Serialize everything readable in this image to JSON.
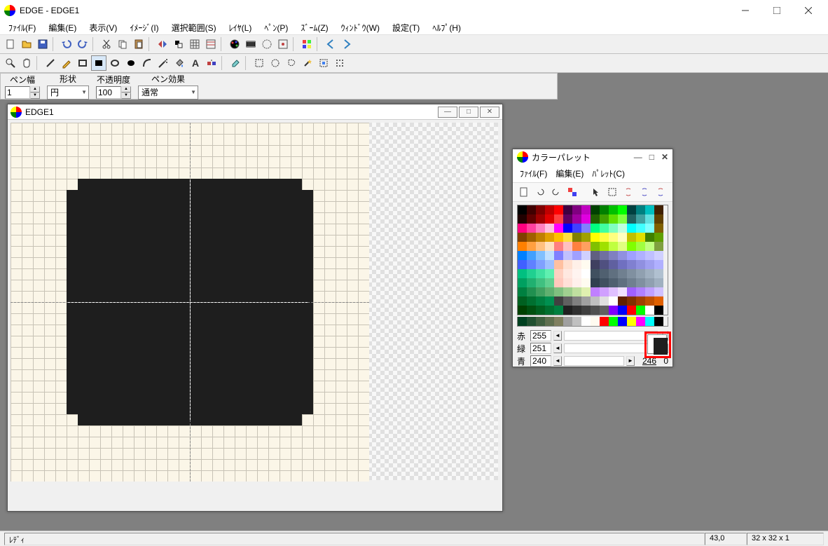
{
  "title": "EDGE - EDGE1",
  "menus": [
    "ﾌｧｲﾙ(F)",
    "編集(E)",
    "表示(V)",
    "ｲﾒｰｼﾞ(I)",
    "選択範囲(S)",
    "ﾚｲﾔ(L)",
    "ﾍﾟﾝ(P)",
    "ｽﾞｰﾑ(Z)",
    "ｳｨﾝﾄﾞｳ(W)",
    "設定(T)",
    "ﾍﾙﾌﾟ(H)"
  ],
  "options": {
    "pen_width": {
      "label": "ペン幅",
      "value": "1"
    },
    "shape": {
      "label": "形状",
      "value": "円"
    },
    "opacity": {
      "label": "不透明度",
      "value": "100"
    },
    "effect": {
      "label": "ペン効果",
      "value": "通常"
    }
  },
  "canvas_window": {
    "title": "EDGE1"
  },
  "palette_window": {
    "title": "カラーパレット",
    "menus": [
      "ﾌｧｲﾙ(F)",
      "編集(E)",
      "ﾊﾟﾚｯﾄ(C)"
    ],
    "rgb": {
      "r_label": "赤",
      "r_value": "255",
      "g_label": "緑",
      "g_value": "251",
      "b_label": "青",
      "b_value": "240",
      "result": "246",
      "result2": "0"
    }
  },
  "status": {
    "left": "ﾚﾃﾞｨ",
    "coords": "43,0",
    "dims": "32 x 32 x 1"
  },
  "palette_colors": [
    "#000000",
    "#400000",
    "#800000",
    "#c00000",
    "#ff0000",
    "#400040",
    "#800080",
    "#c000c0",
    "#004000",
    "#008000",
    "#00c000",
    "#00ff00",
    "#004040",
    "#008080",
    "#00c0c0",
    "#402000",
    "#200000",
    "#600000",
    "#a00000",
    "#e00000",
    "#ff4040",
    "#600060",
    "#a000a0",
    "#e000e0",
    "#206000",
    "#40a000",
    "#60e000",
    "#80ff40",
    "#206060",
    "#40a0a0",
    "#60e0e0",
    "#604000",
    "#ff0080",
    "#ff40a0",
    "#ff80c0",
    "#ffc0e0",
    "#ff00ff",
    "#0000ff",
    "#4040ff",
    "#8080ff",
    "#00ff80",
    "#40ffa0",
    "#80ffc0",
    "#c0ffe0",
    "#00ffff",
    "#40ffff",
    "#80ffff",
    "#806000",
    "#804000",
    "#a06000",
    "#c08000",
    "#e0a000",
    "#ffc000",
    "#ffe040",
    "#808000",
    "#a0a000",
    "#ffff00",
    "#ffff40",
    "#ffff80",
    "#ffffc0",
    "#c0c000",
    "#e0e000",
    "#408000",
    "#60a000",
    "#ff8000",
    "#ffa040",
    "#ffc080",
    "#ffe0c0",
    "#ff8080",
    "#ffc0c0",
    "#ff8040",
    "#ffa060",
    "#80c000",
    "#a0e000",
    "#c0ff40",
    "#e0ff80",
    "#80ff00",
    "#a0ff40",
    "#c0ff80",
    "#80a040",
    "#0080ff",
    "#40a0ff",
    "#80c0ff",
    "#c0e0ff",
    "#8080ff",
    "#c0c0ff",
    "#a0a0ff",
    "#d0d0ff",
    "#606080",
    "#7070a0",
    "#8080c0",
    "#9090e0",
    "#a0a0ff",
    "#b0b0ff",
    "#c0c0ff",
    "#d0d0ff",
    "#4060ff",
    "#6080ff",
    "#80a0ff",
    "#a0c0ff",
    "#ffc0a0",
    "#ffe0d0",
    "#fff0e8",
    "#fffbf0",
    "#404060",
    "#505080",
    "#6060a0",
    "#7070c0",
    "#8080d0",
    "#9090e0",
    "#a0a0f0",
    "#b0b0ff",
    "#00c080",
    "#20d090",
    "#40e0a0",
    "#60f0b0",
    "#ffd0c0",
    "#ffe8e0",
    "#fff4f0",
    "#ffffff",
    "#405060",
    "#506070",
    "#607080",
    "#708090",
    "#8090a0",
    "#90a0b0",
    "#a0b0c0",
    "#b0c0d0",
    "#00a060",
    "#20b070",
    "#40c080",
    "#60d090",
    "#ffc8bc",
    "#ffe0d8",
    "#fff0ec",
    "#fffbf0",
    "#304050",
    "#405060",
    "#506070",
    "#607080",
    "#708090",
    "#8090a0",
    "#90a0b0",
    "#a0b0c0",
    "#008040",
    "#209050",
    "#40a060",
    "#60b070",
    "#80c080",
    "#a0d090",
    "#c0e0a0",
    "#e0f0b0",
    "#c080ff",
    "#d0a0ff",
    "#e0c0ff",
    "#f0e0ff",
    "#a060ff",
    "#b080ff",
    "#c0a0ff",
    "#d0c0ff",
    "#006020",
    "#007030",
    "#008040",
    "#009050",
    "#404040",
    "#606060",
    "#808080",
    "#a0a0a0",
    "#c0c0c0",
    "#e0e0e0",
    "#ffffff",
    "#602000",
    "#803000",
    "#a04000",
    "#c05000",
    "#e06000",
    "#004000",
    "#005010",
    "#006020",
    "#007030",
    "#008040",
    "#202020",
    "#303030",
    "#404040",
    "#505050",
    "#606060",
    "#8000ff",
    "#0000ff",
    "#ff0000",
    "#00ff00",
    "#ffffff",
    "#000000"
  ],
  "palette_row2": [
    "#004020",
    "#205030",
    "#406040",
    "#607050",
    "#808060",
    "#a0a0a0",
    "#c0c0c0",
    "#ffffff",
    "#fffbf0",
    "#ff0000",
    "#00ff00",
    "#0000ff",
    "#ffff00",
    "#ff00ff",
    "#00ffff",
    "#000000"
  ]
}
